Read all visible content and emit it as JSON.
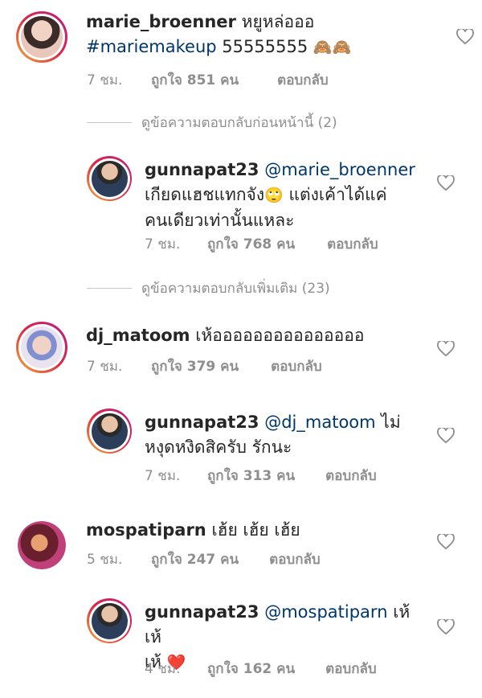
{
  "comments": [
    {
      "username": "marie_broenner",
      "text_line1": "หยูหล่อออ",
      "text_line2_tag": "#mariemakeup",
      "text_line2_rest": "55555555",
      "emojis": "🙈🙈",
      "time": "7 ชม.",
      "likes": "ถูกใจ 851 คน",
      "reply": "ตอบกลับ"
    },
    {
      "username": "gunnapat23",
      "mention": "@marie_broenner",
      "text_line2": "เกียดแฮชแทกจัง",
      "emoji": "🙄",
      "text_line2_rest": "แต่งเค้าได้แค่",
      "text_line3": "คนเดียวเท่านั้นแหละ",
      "time": "7 ชม.",
      "likes": "ถูกใจ 768 คน",
      "reply": "ตอบกลับ"
    },
    {
      "username": "dj_matoom",
      "text": "เห้อออออออออออออออ",
      "time": "7 ชม.",
      "likes": "ถูกใจ 379 คน",
      "reply": "ตอบกลับ"
    },
    {
      "username": "gunnapat23",
      "mention": "@dj_matoom",
      "text_rest": "ไม่",
      "text_line2": "หงุดหงิดสิครับ รักนะ",
      "time": "7 ชม.",
      "likes": "ถูกใจ 313 คน",
      "reply": "ตอบกลับ"
    },
    {
      "username": "mospatiparn",
      "text": "เฮ้ย เฮ้ย เฮ้ย",
      "time": "5 ชม.",
      "likes": "ถูกใจ 247 คน",
      "reply": "ตอบกลับ"
    },
    {
      "username": "gunnapat23",
      "mention": "@mospatiparn",
      "text_rest": "เห้ เห้",
      "text_line2": "เห้",
      "emoji": "❤️",
      "time": "4 ชม.",
      "likes": "ถูกใจ 162 คน",
      "reply": "ตอบกลับ"
    }
  ],
  "view_previous_replies": "ดูข้อความตอบกลับก่อนหน้านี้ (2)",
  "view_more_replies": "ดูข้อความตอบกลับเพิ่มเติม (23)",
  "icons": {
    "like": "heart-outline-icon"
  },
  "colors": {
    "mention": "#00376b",
    "meta": "#8e8e8e",
    "heart_emoji": "#e0245e"
  }
}
